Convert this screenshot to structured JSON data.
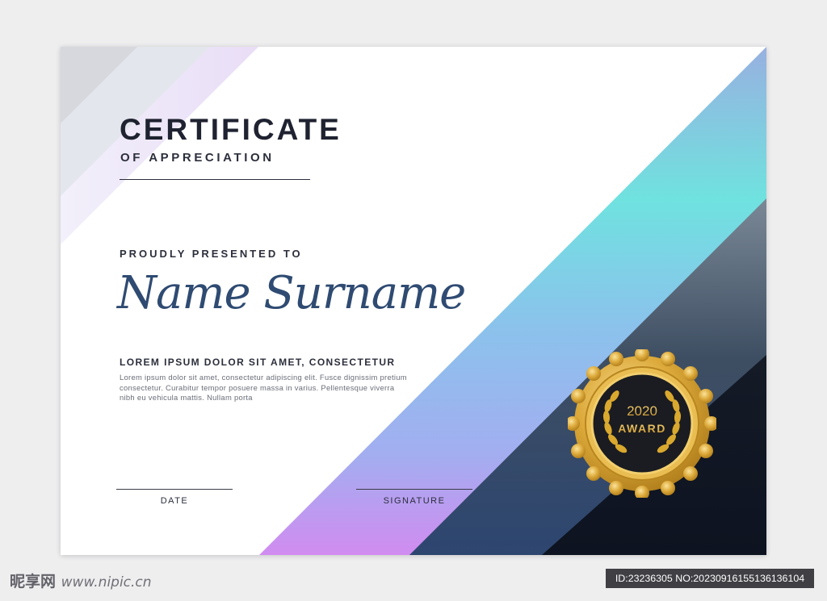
{
  "certificate": {
    "title": "CERTIFICATE",
    "subtitle": "OF APPRECIATION",
    "presented_label": "PROUDLY PRESENTED TO",
    "recipient_name": "Name Surname",
    "lorem_heading": "LOREM IPSUM DOLOR SIT AMET, CONSECTETUR",
    "lorem_body": "Lorem ipsum dolor sit amet, consectetur adipiscing elit. Fusce dignissim pretium consectetur. Curabitur tempor posuere massa in varius. Pellentesque viverra nibh eu vehicula mattis. Nullam porta",
    "date_label": "DATE",
    "signature_label": "SIGNATURE"
  },
  "badge": {
    "year": "2020",
    "label": "AWARD"
  },
  "watermark": {
    "brand": "昵享网",
    "url": "www.nipic.cn",
    "id_text": "ID:23236305 NO:20230916155136136104"
  },
  "colors": {
    "name_text": "#2f4b72",
    "gold": "#d9a82e",
    "badge_dark": "#1c1d22",
    "accent_cyan": "#6fe3df",
    "accent_violet": "#c88cf0"
  }
}
